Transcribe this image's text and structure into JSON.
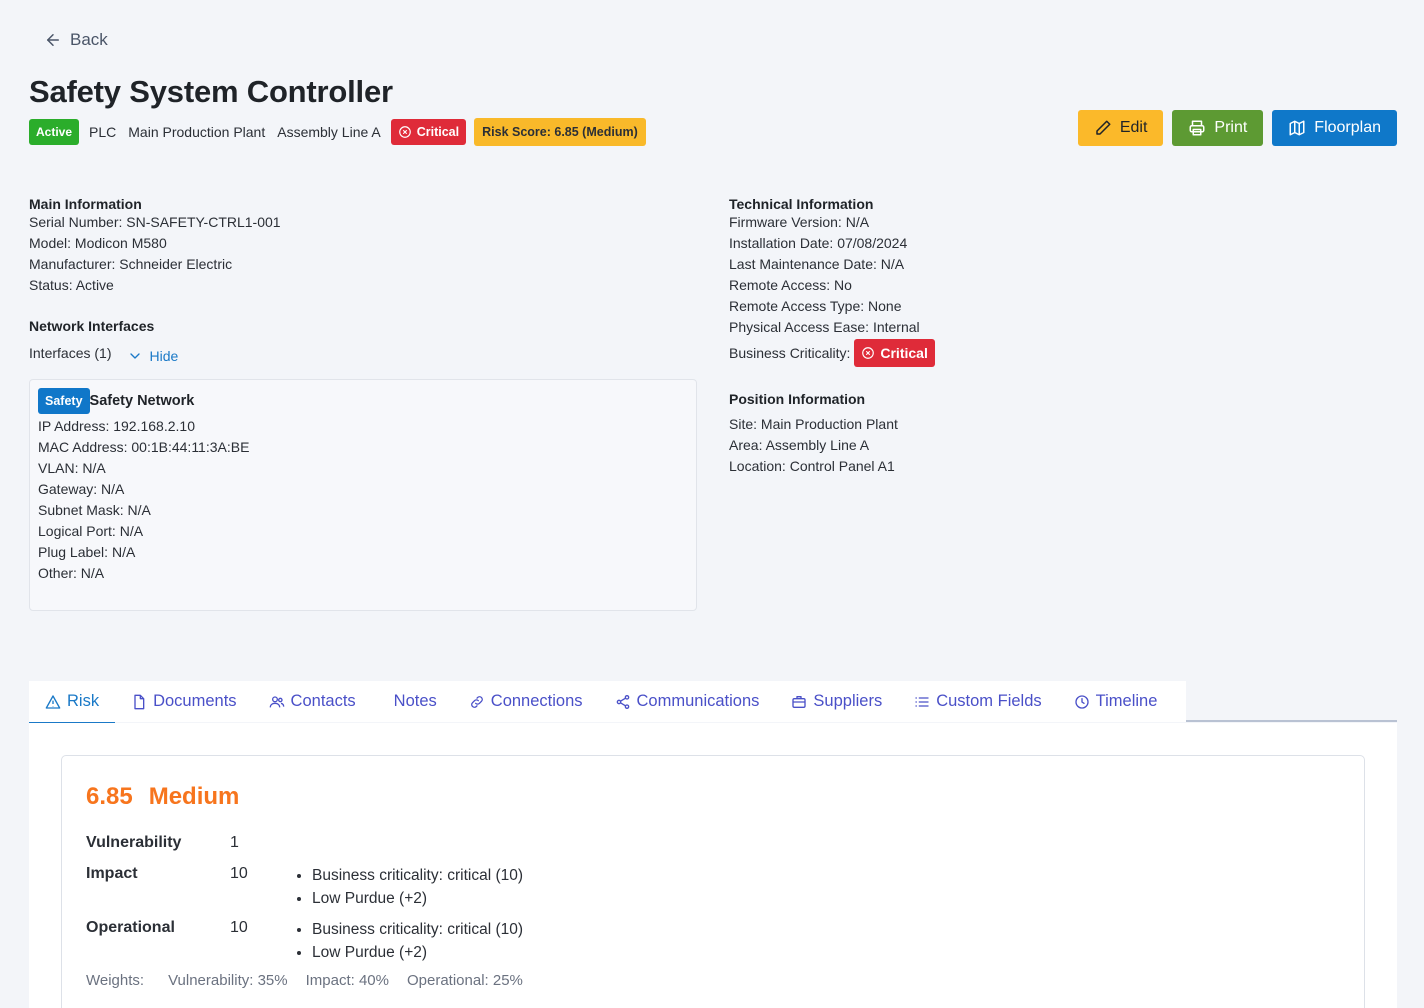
{
  "back_label": "Back",
  "title": "Safety System Controller",
  "meta": {
    "status": "Active",
    "type": "PLC",
    "site": "Main Production Plant",
    "area": "Assembly Line A",
    "criticality": "Critical",
    "risk_score": "Risk Score: 6.85 (Medium)"
  },
  "actions": {
    "edit": "Edit",
    "print": "Print",
    "floorplan": "Floorplan"
  },
  "main_info": {
    "title": "Main Information",
    "rows": [
      {
        "label": "Serial Number:",
        "value": "SN-SAFETY-CTRL1-001"
      },
      {
        "label": "Model:",
        "value": "Modicon M580"
      },
      {
        "label": "Manufacturer:",
        "value": "Schneider Electric"
      },
      {
        "label": "Status:",
        "value": "Active"
      }
    ]
  },
  "network": {
    "title": "Network Interfaces",
    "interfaces_label": "Interfaces (1)",
    "hide_label": "Hide",
    "interface": {
      "tag": "Safety",
      "name": "Safety Network",
      "rows": [
        {
          "label": "IP Address:",
          "value": "192.168.2.10"
        },
        {
          "label": "MAC Address:",
          "value": "00:1B:44:11:3A:BE"
        },
        {
          "label": "VLAN:",
          "value": "N/A"
        },
        {
          "label": "Gateway:",
          "value": "N/A"
        },
        {
          "label": "Subnet Mask:",
          "value": "N/A"
        },
        {
          "label": "Logical Port:",
          "value": "N/A"
        },
        {
          "label": "Plug Label:",
          "value": "N/A"
        },
        {
          "label": "Other:",
          "value": "N/A"
        }
      ]
    }
  },
  "technical": {
    "title": "Technical Information",
    "rows": [
      {
        "label": "Firmware Version:",
        "value": "N/A"
      },
      {
        "label": "Installation Date:",
        "value": "07/08/2024"
      },
      {
        "label": "Last Maintenance Date:",
        "value": "N/A"
      },
      {
        "label": "Remote Access:",
        "value": "No"
      },
      {
        "label": "Remote Access Type:",
        "value": "None"
      },
      {
        "label": "Physical Access Ease:",
        "value": "Internal"
      }
    ],
    "criticality_label": "Business Criticality:",
    "criticality_value": "Critical"
  },
  "position": {
    "title": "Position Information",
    "rows": [
      {
        "label": "Site:",
        "value": "Main Production Plant"
      },
      {
        "label": "Area:",
        "value": "Assembly Line A"
      },
      {
        "label": "Location:",
        "value": "Control Panel A1"
      }
    ]
  },
  "tabs": [
    {
      "label": "Risk",
      "icon": "warning-icon"
    },
    {
      "label": "Documents",
      "icon": "document-icon"
    },
    {
      "label": "Contacts",
      "icon": "users-icon"
    },
    {
      "label": "Notes",
      "icon": ""
    },
    {
      "label": "Connections",
      "icon": "link-icon"
    },
    {
      "label": "Communications",
      "icon": "share-icon"
    },
    {
      "label": "Suppliers",
      "icon": "briefcase-icon"
    },
    {
      "label": "Custom Fields",
      "icon": "list-icon"
    },
    {
      "label": "Timeline",
      "icon": "clock-icon"
    }
  ],
  "risk": {
    "score": "6.85",
    "level": "Medium",
    "vulnerability_label": "Vulnerability",
    "vulnerability_value": "1",
    "impact_label": "Impact",
    "impact_value": "10",
    "impact_items": [
      "Business criticality: critical (10)",
      "Low Purdue (+2)"
    ],
    "operational_label": "Operational",
    "operational_value": "10",
    "operational_items": [
      "Business criticality: critical (10)",
      "Low Purdue (+2)"
    ],
    "weights_label": "Weights:",
    "weights": [
      "Vulnerability: 35%",
      "Impact: 40%",
      "Operational: 25%"
    ]
  },
  "colors": {
    "active": "#2bad2b",
    "critical": "#df2b39",
    "risk_badge": "#f9b92a",
    "edit": "#fbb92a",
    "print": "#5d9a33",
    "floorplan": "#0f78c9",
    "risk_medium": "#f7751d",
    "tab_text": "#4a50c8"
  }
}
